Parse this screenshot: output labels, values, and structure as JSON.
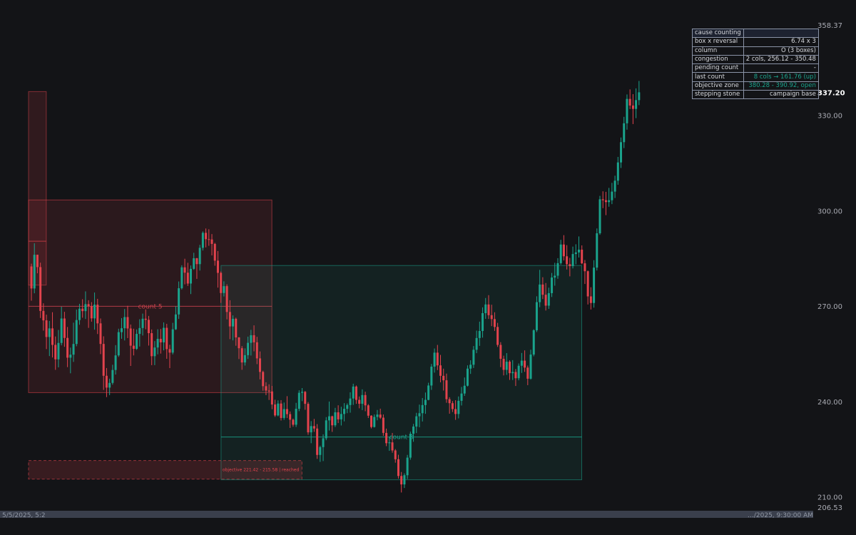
{
  "chart_data": {
    "type": "candlestick",
    "y_axis": {
      "ticks": [
        210,
        240,
        270,
        300,
        330
      ],
      "tick_labels": [
        "210.00",
        "240.00",
        "270.00",
        "300.00",
        "330.00"
      ],
      "top_label": "358.37",
      "bottom_label": "206.53",
      "last_price": "337.20",
      "ylim": [
        206.53,
        358.37
      ]
    },
    "x_axis": {
      "first_label": "5/5/2025, 5:2",
      "last_label": "…/2025, 9:30:00 AM",
      "bar_count": 200
    },
    "colors": {
      "up": "#1aa38c",
      "down": "#e2434d"
    },
    "ohlc": [
      [
        282.45,
        283.31,
        271.68,
        275.52
      ],
      [
        275.52,
        289.73,
        274.01,
        286.12
      ],
      [
        286.12,
        286.12,
        280.3,
        282.24
      ],
      [
        282.24,
        283.63,
        266.24,
        268.46
      ],
      [
        268.46,
        270.86,
        262.27,
        265.49
      ],
      [
        265.49,
        267.29,
        256.46,
        260.26
      ],
      [
        260.26,
        265.31,
        254.27,
        262.97
      ],
      [
        262.97,
        268.05,
        253.82,
        257.78
      ],
      [
        257.78,
        260.43,
        249.94,
        253.23
      ],
      [
        253.23,
        262.48,
        250.72,
        258.39
      ],
      [
        258.39,
        269.79,
        257.64,
        266.08
      ],
      [
        266.08,
        268.18,
        257.18,
        259.97
      ],
      [
        259.97,
        263.41,
        250.79,
        253.76
      ],
      [
        253.76,
        256.92,
        248.85,
        254.71
      ],
      [
        254.71,
        264.77,
        252.43,
        258.07
      ],
      [
        258.07,
        268.89,
        257.35,
        265.59
      ],
      [
        265.59,
        270.69,
        264.11,
        269.16
      ],
      [
        269.16,
        272.14,
        266.33,
        268.4
      ],
      [
        268.4,
        274.61,
        265.93,
        270.6
      ],
      [
        270.6,
        271.83,
        263.13,
        269.97
      ],
      [
        269.97,
        271.22,
        265.08,
        266.12
      ],
      [
        266.12,
        274.25,
        262.57,
        270.43
      ],
      [
        270.43,
        272.26,
        261.19,
        264.55
      ],
      [
        264.55,
        266.09,
        254.87,
        258.08
      ],
      [
        258.08,
        260.48,
        243.62,
        248.07
      ],
      [
        248.07,
        250.51,
        241.37,
        244.35
      ],
      [
        244.35,
        247.16,
        241.98,
        245.83
      ],
      [
        245.83,
        251.53,
        245.28,
        249.89
      ],
      [
        249.89,
        257.71,
        248.45,
        254.48
      ],
      [
        254.48,
        262.87,
        254.01,
        261.79
      ],
      [
        261.79,
        266.2,
        259.7,
        263.01
      ],
      [
        263.01,
        269.07,
        259.17,
        266.53
      ],
      [
        266.53,
        270.07,
        259.92,
        262.94
      ],
      [
        262.94,
        264.19,
        251.16,
        257.53
      ],
      [
        257.53,
        262.87,
        254.47,
        256.54
      ],
      [
        256.54,
        262.64,
        256.21,
        261.24
      ],
      [
        261.24,
        265.85,
        257.26,
        263.08
      ],
      [
        263.08,
        267.62,
        260.73,
        266.01
      ],
      [
        266.01,
        268.93,
        262.69,
        265.66
      ],
      [
        265.66,
        266.89,
        257.57,
        261.47
      ],
      [
        261.47,
        262.63,
        251.41,
        254.23
      ],
      [
        254.23,
        258.98,
        251.42,
        256.96
      ],
      [
        256.96,
        262.7,
        254.81,
        259.68
      ],
      [
        259.68,
        262.79,
        255.05,
        258.57
      ],
      [
        258.57,
        264.86,
        256.06,
        263.15
      ],
      [
        263.15,
        264.4,
        253.4,
        256.46
      ],
      [
        256.46,
        257.82,
        250.48,
        255.35
      ],
      [
        255.35,
        264.72,
        254.79,
        262.68
      ],
      [
        262.68,
        269.95,
        262.47,
        267.35
      ],
      [
        267.35,
        277.72,
        265.96,
        275.59
      ],
      [
        275.59,
        282.81,
        275.18,
        282.16
      ],
      [
        282.16,
        284.87,
        276.82,
        280.48
      ],
      [
        280.48,
        283.6,
        276.32,
        277.07
      ],
      [
        277.07,
        282.75,
        273.76,
        281.69
      ],
      [
        281.69,
        286.74,
        281.38,
        285.02
      ],
      [
        285.02,
        285.14,
        278.54,
        283.18
      ],
      [
        283.18,
        289.24,
        281.16,
        288.3
      ],
      [
        288.3,
        293.47,
        287.45,
        293.01
      ],
      [
        293.01,
        294.38,
        288.44,
        291.02
      ],
      [
        291.02,
        294.14,
        288.94,
        290.93
      ],
      [
        290.93,
        292.62,
        285.92,
        289.53
      ],
      [
        289.53,
        289.86,
        282.67,
        284.27
      ],
      [
        284.27,
        287.3,
        275.78,
        280.43
      ],
      [
        280.43,
        280.88,
        270.98,
        274.09
      ],
      [
        274.09,
        277.77,
        273.01,
        276.25
      ],
      [
        276.25,
        276.83,
        265.81,
        268.13
      ],
      [
        268.13,
        271.83,
        259.59,
        263.58
      ],
      [
        263.58,
        267.06,
        259.2,
        265.98
      ],
      [
        265.98,
        266.35,
        257.51,
        260.13
      ],
      [
        260.13,
        260.24,
        253.33,
        256.73
      ],
      [
        256.73,
        257.41,
        249.96,
        252.26
      ],
      [
        252.26,
        256.69,
        251.29,
        254.55
      ],
      [
        254.55,
        260.38,
        253.37,
        258.43
      ],
      [
        258.43,
        262.51,
        254.44,
        260.82
      ],
      [
        260.82,
        263.92,
        255.76,
        258.59
      ],
      [
        258.59,
        260.32,
        251.72,
        253.54
      ],
      [
        253.54,
        255.72,
        246.94,
        249.28
      ],
      [
        249.28,
        249.67,
        243.37,
        244.8
      ],
      [
        244.8,
        246.04,
        241.98,
        243.43
      ],
      [
        243.43,
        245.39,
        240.47,
        243.14
      ],
      [
        243.14,
        244.89,
        237.55,
        239.03
      ],
      [
        239.03,
        240.54,
        235.14,
        235.6
      ],
      [
        235.6,
        240.34,
        235.32,
        239.34
      ],
      [
        239.34,
        240.41,
        234.01,
        234.81
      ],
      [
        234.81,
        239.66,
        234.22,
        237.6
      ],
      [
        237.6,
        241.66,
        234.78,
        236.01
      ],
      [
        236.01,
        236.85,
        231.67,
        234.26
      ],
      [
        234.26,
        234.62,
        232.04,
        232.68
      ],
      [
        232.68,
        239.56,
        231.97,
        237.69
      ],
      [
        237.69,
        243.51,
        236.94,
        242.72
      ],
      [
        242.72,
        244.21,
        240.09,
        243.02
      ],
      [
        243.02,
        243.28,
        237.38,
        239.25
      ],
      [
        239.25,
        239.82,
        229.52,
        230.28
      ],
      [
        230.28,
        233.82,
        226.87,
        232.25
      ],
      [
        232.25,
        234.51,
        230.44,
        231.48
      ],
      [
        231.48,
        232.88,
        221.95,
        223.18
      ],
      [
        223.18,
        226.09,
        220.99,
        225.64
      ],
      [
        225.64,
        229.66,
        221.25,
        228.41
      ],
      [
        228.41,
        235.07,
        227.81,
        234.05
      ],
      [
        234.05,
        239.97,
        230.85,
        235.33
      ],
      [
        235.33,
        235.52,
        230.43,
        232.5
      ],
      [
        232.5,
        237.98,
        231.96,
        236.58
      ],
      [
        236.58,
        238.79,
        233.2,
        234.36
      ],
      [
        234.36,
        238.33,
        232.44,
        236.06
      ],
      [
        236.06,
        239.47,
        233.73,
        237.67
      ],
      [
        237.67,
        239.38,
        236.31,
        238.87
      ],
      [
        238.87,
        242.87,
        236.47,
        240.92
      ],
      [
        240.92,
        245.57,
        238.92,
        244.68
      ],
      [
        244.68,
        245.02,
        239.25,
        240.49
      ],
      [
        240.49,
        241.56,
        237.84,
        239.27
      ],
      [
        239.27,
        243.81,
        237.28,
        242.01
      ],
      [
        242.01,
        243.07,
        236.92,
        238.77
      ],
      [
        238.77,
        239.16,
        234.79,
        235.52
      ],
      [
        235.52,
        235.66,
        231.52,
        231.96
      ],
      [
        231.96,
        235.91,
        231.8,
        235.13
      ],
      [
        235.13,
        237.32,
        234.07,
        235.87
      ],
      [
        235.87,
        237.73,
        234.49,
        234.9
      ],
      [
        234.9,
        235.91,
        229.21,
        230.11
      ],
      [
        230.11,
        231.46,
        225.94,
        226.87
      ],
      [
        226.87,
        228.84,
        224.48,
        227.13
      ],
      [
        227.13,
        230.09,
        223.87,
        224.59
      ],
      [
        224.59,
        225.02,
        220.74,
        221.82
      ],
      [
        221.82,
        223.23,
        215.75,
        216.56
      ],
      [
        216.56,
        217.81,
        211.38,
        213.91
      ],
      [
        213.91,
        217.38,
        212.78,
        216.8
      ],
      [
        216.8,
        223.19,
        215.62,
        222.33
      ],
      [
        222.33,
        230.52,
        221.67,
        229.84
      ],
      [
        229.84,
        232.93,
        227.32,
        232.11
      ],
      [
        232.11,
        236.43,
        230.05,
        235.33
      ],
      [
        235.33,
        239.01,
        231.88,
        236.3
      ],
      [
        236.3,
        241.07,
        233.7,
        238.86
      ],
      [
        238.86,
        242.81,
        236.11,
        240.49
      ],
      [
        240.49,
        245.88,
        240.36,
        245.01
      ],
      [
        245.01,
        251.78,
        243.65,
        250.95
      ],
      [
        250.95,
        256.65,
        249.06,
        255.34
      ],
      [
        255.34,
        257.77,
        249.86,
        251.34
      ],
      [
        251.34,
        254.63,
        246.01,
        248.06
      ],
      [
        248.06,
        250.31,
        243.43,
        246.65
      ],
      [
        246.65,
        248.76,
        239.58,
        240.71
      ],
      [
        240.71,
        241.32,
        236.14,
        239.45
      ],
      [
        239.45,
        240.13,
        236.68,
        237.6
      ],
      [
        237.6,
        240.39,
        234.21,
        236.05
      ],
      [
        236.05,
        241.57,
        234.68,
        240.2
      ],
      [
        240.2,
        244.55,
        238.73,
        242.49
      ],
      [
        242.49,
        247.53,
        241.74,
        244.94
      ],
      [
        244.94,
        251.35,
        244.7,
        250.32
      ],
      [
        250.32,
        252.95,
        248.66,
        251.54
      ],
      [
        251.54,
        257.42,
        250.51,
        256.25
      ],
      [
        256.25,
        262.27,
        255.18,
        259.94
      ],
      [
        259.94,
        265.09,
        257.48,
        262.15
      ],
      [
        262.15,
        269.58,
        260.07,
        267.76
      ],
      [
        267.76,
        272.53,
        265.97,
        270.49
      ],
      [
        270.49,
        273.42,
        265.94,
        267.12
      ],
      [
        267.12,
        270.41,
        263.68,
        265.9
      ],
      [
        265.9,
        268.04,
        262.18,
        263.42
      ],
      [
        263.42,
        264.7,
        257.14,
        257.78
      ],
      [
        257.78,
        258.64,
        250.78,
        253.41
      ],
      [
        253.41,
        254.39,
        248.19,
        249.93
      ],
      [
        249.93,
        255.19,
        248.36,
        252.49
      ],
      [
        252.49,
        252.96,
        246.77,
        248.89
      ],
      [
        248.89,
        252.99,
        246.75,
        249.26
      ],
      [
        249.26,
        250.19,
        244.86,
        247.3
      ],
      [
        247.3,
        251.94,
        246.65,
        251.22
      ],
      [
        251.22,
        255.24,
        248.97,
        252.83
      ],
      [
        252.83,
        256.06,
        249.3,
        250.64
      ],
      [
        250.64,
        251.28,
        245.12,
        247.15
      ],
      [
        247.15,
        256.26,
        246.86,
        254.74
      ],
      [
        254.74,
        262.7,
        254.19,
        262.38
      ],
      [
        262.38,
        273.06,
        261.82,
        271.22
      ],
      [
        271.22,
        281.37,
        269.63,
        276.76
      ],
      [
        276.76,
        279.06,
        272.19,
        273.55
      ],
      [
        273.55,
        277.24,
        268.59,
        270.12
      ],
      [
        270.12,
        275.77,
        269.11,
        274.05
      ],
      [
        274.05,
        280.4,
        272.85,
        278.96
      ],
      [
        278.96,
        283.6,
        276.39,
        279.54
      ],
      [
        279.54,
        285.05,
        278.56,
        283.48
      ],
      [
        283.48,
        290.81,
        283.0,
        289.34
      ],
      [
        289.34,
        292.28,
        284.32,
        285.64
      ],
      [
        285.64,
        289.15,
        281.49,
        283.16
      ],
      [
        283.16,
        285.14,
        279.33,
        282.55
      ],
      [
        282.55,
        288.69,
        281.82,
        286.35
      ],
      [
        286.35,
        289.42,
        283.12,
        286.85
      ],
      [
        286.85,
        291.88,
        285.25,
        287.72
      ],
      [
        287.72,
        289.07,
        283.15,
        283.43
      ],
      [
        283.43,
        284.47,
        276.94,
        280.94
      ],
      [
        280.94,
        281.18,
        270.49,
        273.03
      ],
      [
        273.03,
        275.91,
        268.91,
        270.96
      ],
      [
        270.96,
        284.42,
        269.5,
        282.08
      ],
      [
        282.08,
        294.39,
        281.17,
        292.87
      ],
      [
        292.87,
        304.64,
        292.4,
        303.56
      ],
      [
        303.56,
        306.07,
        300.77,
        303.26
      ],
      [
        303.26,
        305.9,
        298.57,
        302.69
      ],
      [
        302.69,
        307.14,
        301.22,
        303.26
      ],
      [
        303.26,
        308.73,
        302.04,
        305.97
      ],
      [
        305.97,
        310.98,
        303.96,
        309.41
      ],
      [
        309.41,
        316.89,
        308.13,
        315.15
      ],
      [
        315.15,
        322.99,
        313.4,
        321.52
      ],
      [
        321.52,
        329.49,
        319.65,
        327.45
      ],
      [
        327.45,
        336.52,
        325.46,
        335.12
      ],
      [
        335.12,
        338.11,
        331.93,
        333.04
      ],
      [
        333.04,
        336.62,
        327.21,
        331.98
      ],
      [
        331.98,
        338.43,
        329.07,
        334.74
      ],
      [
        334.74,
        340.77,
        333.17,
        337.2
      ]
    ],
    "zones": [
      {
        "label": "count 5",
        "tone": "bear",
        "from_bar": 0,
        "to_bar": 79,
        "high": 303.35,
        "low": 242.77,
        "count_line": 269.92
      },
      {
        "label": "count 8",
        "tone": "bull",
        "from_bar": 64,
        "to_bar": 182,
        "high": 282.74,
        "low": 215.37,
        "count_line": 228.82
      }
    ],
    "objective": {
      "text": "objective 221.42 - 215.58 | reached",
      "from_bar": 0,
      "to_bar": 89,
      "high": 221.42,
      "low": 215.58
    },
    "stepping_stone": {
      "from_bar": 0,
      "to_bar": 4,
      "high": 337.43,
      "low": 276.58,
      "mid": 290.38
    }
  },
  "info_table": {
    "title": "cause counting",
    "rows": [
      {
        "key": "box x reversal",
        "value": "6.74 x 3"
      },
      {
        "key": "column",
        "value": "O (3 boxes)"
      },
      {
        "key": "congestion",
        "value": "2 cols, 256.12 - 350.48"
      },
      {
        "key": "pending count",
        "value": "-"
      },
      {
        "key": "last count",
        "value": "8 cols → 161.76 (up)"
      },
      {
        "key": "objective zone",
        "value": "380.28 - 390.92, open"
      },
      {
        "key": "stepping stone",
        "value": "campaign base"
      }
    ]
  }
}
